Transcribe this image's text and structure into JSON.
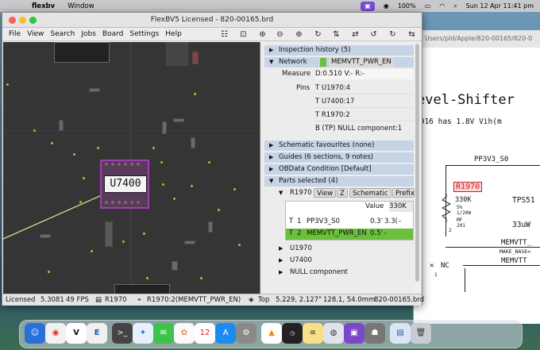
{
  "menubar": {
    "app_name": "flexbv",
    "window_menu": "Window",
    "battery": "100%",
    "datetime": "Sun 12 Apr  11:41 pm"
  },
  "schematic": {
    "path": "Users/pld/Apple/820-00165/820-0",
    "heading": "evel-Shifter",
    "note": "1916 has 1.8V Vih(m",
    "net_top": "PP3V3_S0",
    "ref": "R1970",
    "value": "330K",
    "spec1": "5%",
    "spec2": "1/20W",
    "spec3": "MF",
    "spec4": "201",
    "pin": "2",
    "chip": "TPS51",
    "cap": "33uW",
    "net_mem": "MEMVTT_",
    "net_make": "MAKE_BASE=",
    "net_mem2": "MEMVTT",
    "nc": "NC",
    "nc_pin": "1"
  },
  "window": {
    "title": "FlexBV5 Licensed - 820-00165.brd",
    "menus": [
      "File",
      "View",
      "Search",
      "Jobs",
      "Board",
      "Settings",
      "Help"
    ]
  },
  "board": {
    "selected_label": "U7400"
  },
  "panel": {
    "inspection": "Inspection history (5)",
    "network": "Network",
    "network_value": "MEMVTT_PWR_EN",
    "measure_label": "Measure",
    "measure_value": "D:0.510  V:-   R:-",
    "pins_label": "Pins",
    "pins": [
      "T U1970:4",
      "T U7400:17",
      "T R1970:2",
      "B (TP) NULL component:1"
    ],
    "schem_favs": "Schematic favourites (none)",
    "guides": "Guides (6 sections, 9 notes)",
    "obdata": "OBData Condition [Default]",
    "parts_selected": "Parts selected (4)",
    "part_r1970": "R1970",
    "btn_view": "View",
    "btn_z": "Z",
    "btn_schematic": "Schematic",
    "btn_prefix": "Prefix",
    "value_label": "Value",
    "value_val": "330K",
    "pin_rows": [
      {
        "side": "T",
        "num": "1",
        "net": "PP3V3_S0",
        "v": "0.3’",
        "r": "3.3(",
        "x": "-"
      },
      {
        "side": "T",
        "num": "2",
        "net": "MEMVTT_PWR_EN",
        "v": "0.5’",
        "r": "-",
        "x": ""
      }
    ],
    "parts": [
      "U1970",
      "U7400",
      "NULL component"
    ]
  },
  "status": {
    "licensed": "Licensed",
    "version": "5.3081",
    "fps": "49 FPS",
    "part": "R1970",
    "pin": "R1970:2(MEMVTT_PWR_EN)",
    "side": "Top",
    "coords": "5.229, 2.127\"",
    "mm": "128.1, 54.0mm",
    "file": "820-00165.brd"
  },
  "colors": {
    "accent_red": "#d21b1b",
    "selected_row": "#6bbf3c",
    "section_bg": "#c7d4e6",
    "net_green": "#6bbf3c"
  }
}
